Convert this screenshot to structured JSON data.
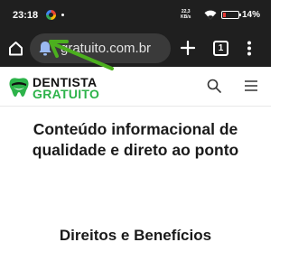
{
  "status_bar": {
    "time": "23:18",
    "net_speed_value": "22,3",
    "net_speed_unit": "KB/s",
    "battery_percent": "14%",
    "battery_color": "#e53935"
  },
  "browser": {
    "url": "gratuito.com.br",
    "tab_count": "1",
    "icons": [
      "home-icon",
      "notification-bell-icon",
      "plus-icon",
      "tab-switcher-icon",
      "more-vert-icon"
    ],
    "annotation_arrow_color": "#4caf1e"
  },
  "site": {
    "logo_line1": "DENTISTA",
    "logo_line2": "GRATUITO",
    "brand_color": "#2db34a",
    "icons": [
      "search-icon",
      "hamburger-menu-icon"
    ]
  },
  "content": {
    "hero_title": "Conteúdo informacional de qualidade e direto ao ponto",
    "section_title": "Direitos e Benefícios"
  }
}
